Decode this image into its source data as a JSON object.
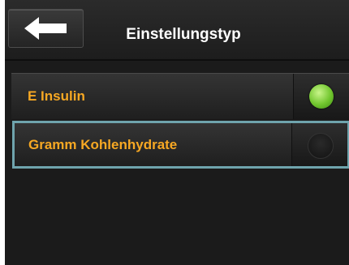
{
  "header": {
    "title": "Einstellungstyp",
    "back_icon": "arrow-left-icon"
  },
  "options": [
    {
      "label": "E Insulin",
      "selected": true,
      "focused": false
    },
    {
      "label": "Gramm Kohlenhydrate",
      "selected": false,
      "focused": true
    }
  ],
  "colors": {
    "label": "#f7a823",
    "title": "#ffffff",
    "focus_frame": "#6fa4ad",
    "radio_on": "#71c62e",
    "background": "#1b1b1b"
  }
}
